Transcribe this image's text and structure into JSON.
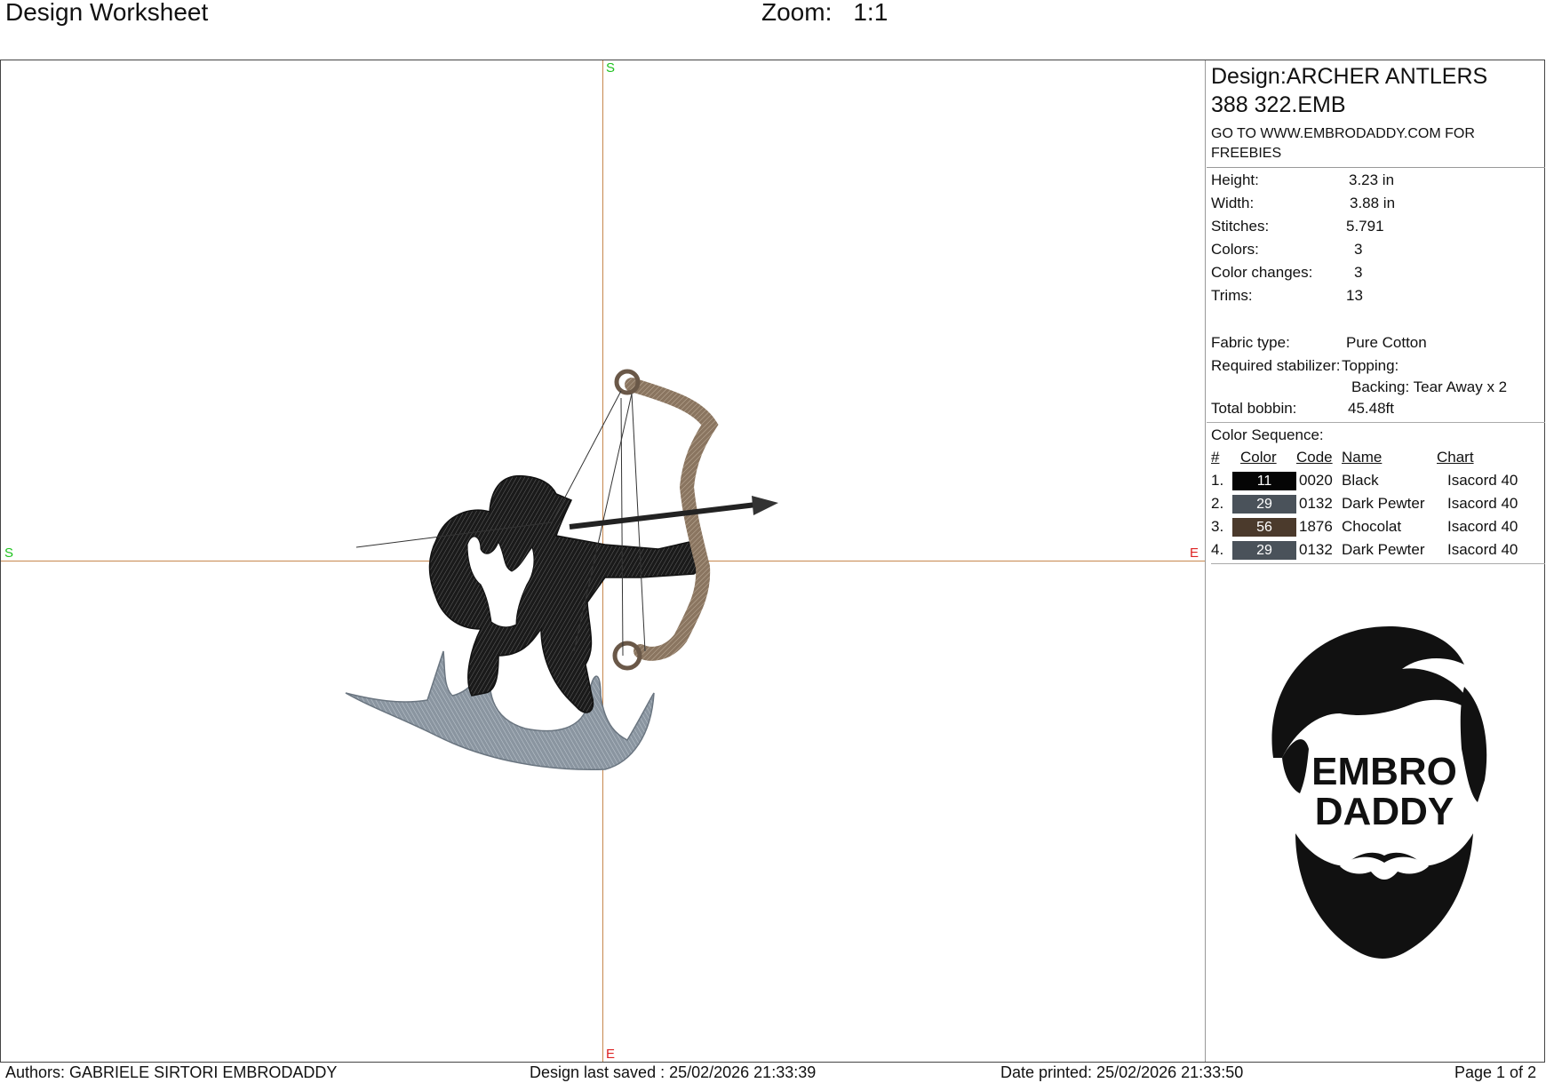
{
  "header": {
    "title": "Design Worksheet",
    "zoom_label": "Zoom:",
    "zoom_value": "1:1"
  },
  "canvas": {
    "markers": {
      "top": "S",
      "left": "S",
      "right": "E",
      "bottom": "E"
    },
    "marker_colors": {
      "start": "#1ec21e",
      "end": "#dd2222"
    },
    "axis_color": "#c7874e",
    "design_icon": "archer-with-antlers-embroidery"
  },
  "info": {
    "design_line1": "Design:ARCHER ANTLERS",
    "design_line2": "388 322.EMB",
    "promo_line1": "GO TO WWW.EMBRODADDY.COM FOR",
    "promo_line2": "FREEBIES",
    "height_label": "Height:",
    "height_value": "3.23 in",
    "width_label": "Width:",
    "width_value": "3.88 in",
    "stitches_label": "Stitches:",
    "stitches_value": "5.791",
    "colors_label": "Colors:",
    "colors_value": "3",
    "changes_label": "Color changes:",
    "changes_value": "3",
    "trims_label": "Trims:",
    "trims_value": "13",
    "fabric_label": "Fabric type:",
    "fabric_value": "Pure Cotton",
    "stabilizer_label": "Required stabilizer:",
    "topping": "Topping:",
    "backing": "Backing: Tear Away x 2",
    "bobbin_label": "Total bobbin:",
    "bobbin_value": "45.48ft"
  },
  "sequence": {
    "title": "Color Sequence:",
    "headers": {
      "num": "#",
      "color": "Color",
      "code": "Code",
      "name": "Name",
      "chart": "Chart"
    },
    "rows": [
      {
        "num": "1.",
        "swatch": "11",
        "hex": "#050505",
        "code": "0020",
        "name": "Black",
        "chart": "Isacord 40"
      },
      {
        "num": "2.",
        "swatch": "29",
        "hex": "#4a525a",
        "code": "0132",
        "name": "Dark Pewter",
        "chart": "Isacord 40"
      },
      {
        "num": "3.",
        "swatch": "56",
        "hex": "#4b3a2c",
        "code": "1876",
        "name": "Chocolat",
        "chart": "Isacord 40"
      },
      {
        "num": "4.",
        "swatch": "29",
        "hex": "#4a525a",
        "code": "0132",
        "name": "Dark Pewter",
        "chart": "Isacord 40"
      }
    ]
  },
  "logo": {
    "line1": "EMBRO",
    "line2": "DADDY",
    "icon": "bearded-man-logo"
  },
  "footer": {
    "authors": "Authors: GABRIELE SIRTORI EMBRODADDY",
    "saved": "Design last saved : 25/02/2026 21:33:39",
    "printed": "Date printed: 25/02/2026 21:33:50",
    "page": "Page 1 of 2"
  }
}
